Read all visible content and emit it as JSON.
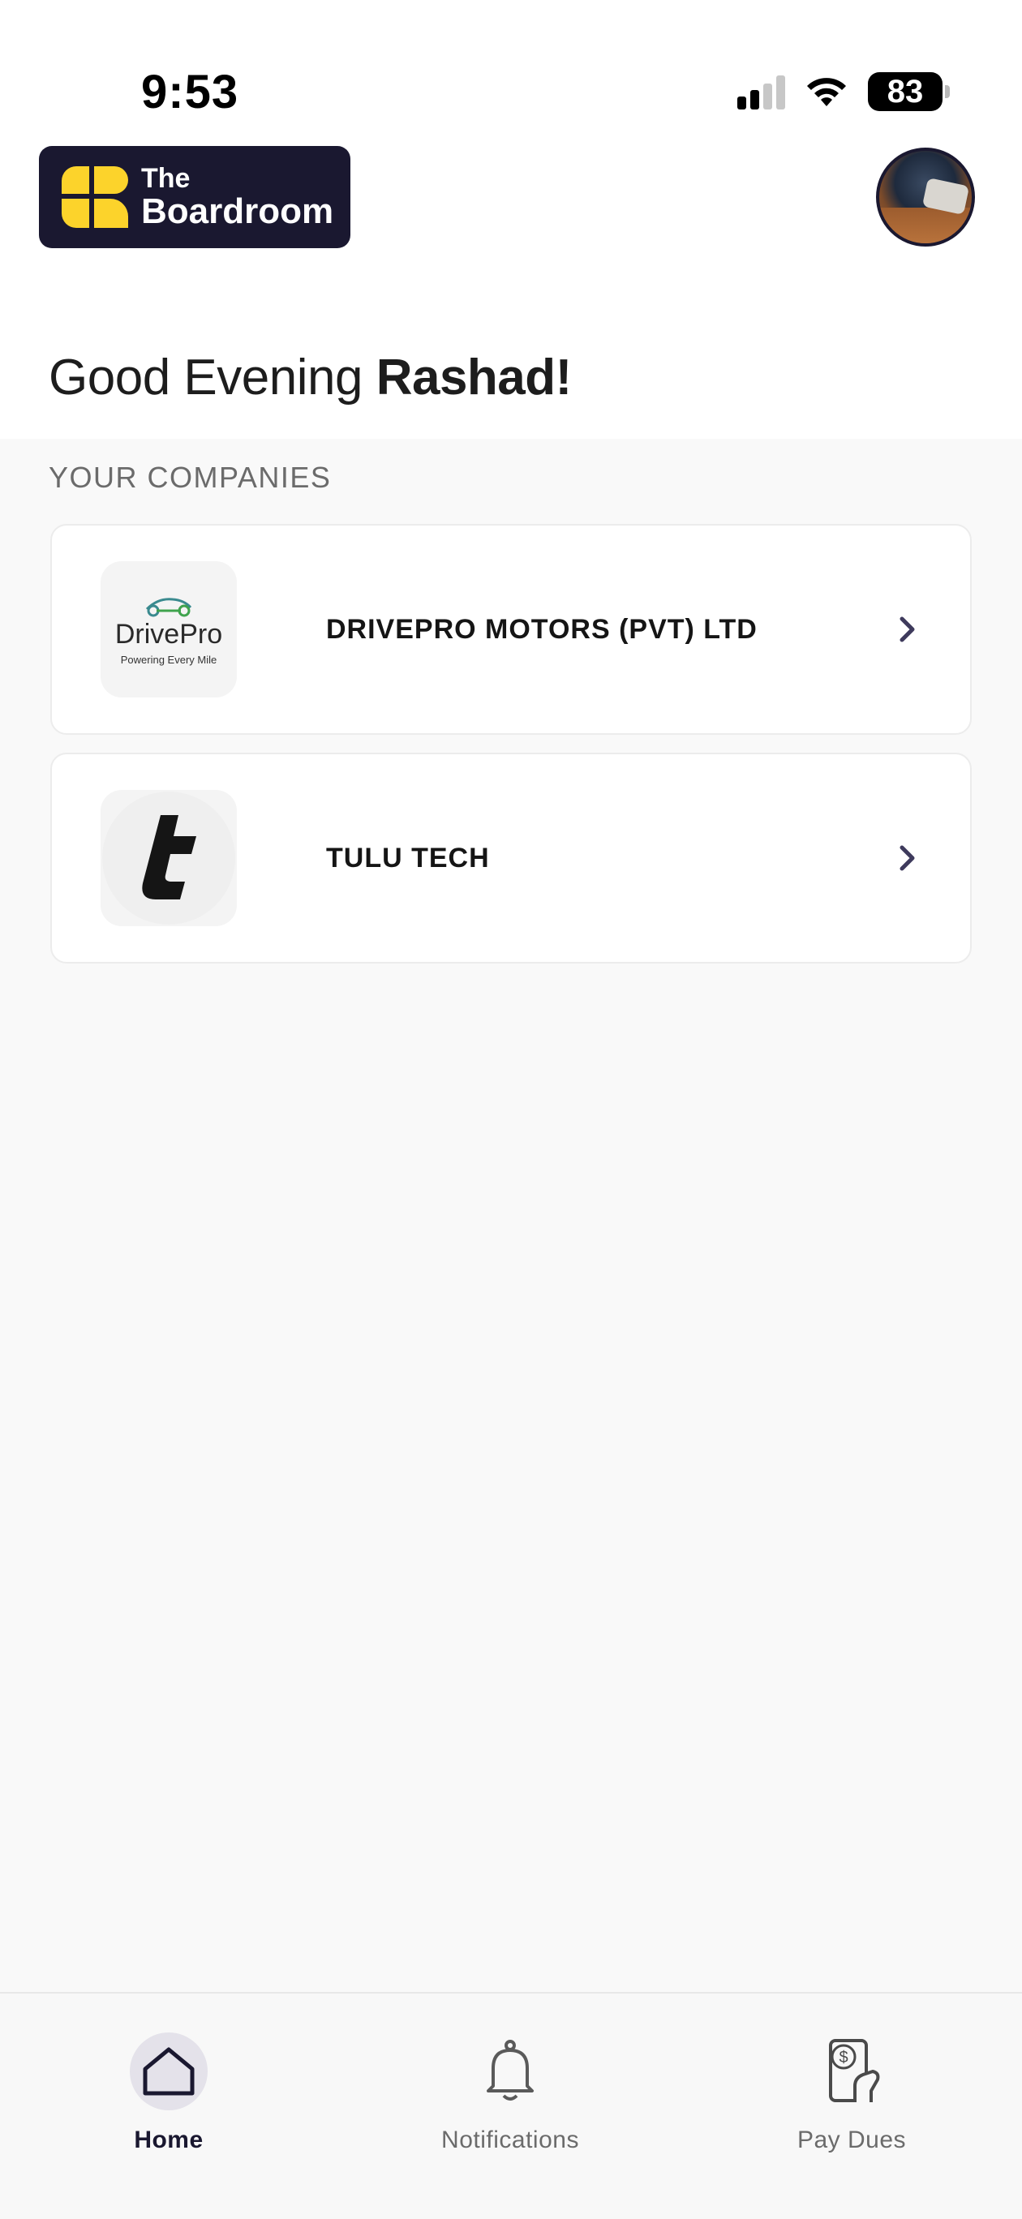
{
  "status_bar": {
    "time": "9:53",
    "battery": "83"
  },
  "header": {
    "logo_line1": "The",
    "logo_line2": "Boardroom",
    "brand_color": "#1a1830",
    "accent_color": "#fcd32b"
  },
  "greeting": {
    "prefix": "Good Evening",
    "name": "Rashad!"
  },
  "companies": {
    "section_label": "YOUR COMPANIES",
    "items": [
      {
        "name": "DRIVEPRO MOTORS (PVT) LTD",
        "logo_name": "DrivePro",
        "logo_tagline": "Powering Every Mile",
        "icon": "drivepro-logo"
      },
      {
        "name": "TULU TECH",
        "icon": "tulu-tech-logo"
      }
    ]
  },
  "bottom_nav": {
    "items": [
      {
        "label": "Home",
        "icon": "home-icon",
        "active": true
      },
      {
        "label": "Notifications",
        "icon": "bell-icon",
        "active": false
      },
      {
        "label": "Pay Dues",
        "icon": "pay-dues-icon",
        "active": false
      }
    ]
  }
}
